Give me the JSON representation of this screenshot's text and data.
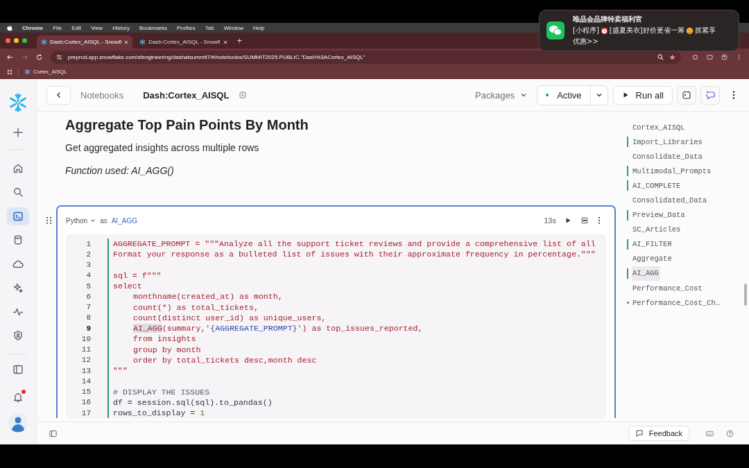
{
  "menu_bar": {
    "app": "Chrome",
    "items": [
      "File",
      "Edit",
      "View",
      "History",
      "Bookmarks",
      "Profiles",
      "Tab",
      "Window",
      "Help"
    ]
  },
  "browser": {
    "tabs": [
      {
        "title": "Dash:Cortex_AISQL - Snowfl",
        "selected": true
      },
      {
        "title": "Dash:Cortex_AISQL - Snowfl",
        "selected": false
      }
    ],
    "new_tab": "+",
    "url": "preprod.app.snowflake.com/sfengineering/dashatsummit7/#/notebooks/SUMMIT2025.PUBLIC.\"Dash%3ACortex_AISQL\"",
    "bookmarks": [
      "Cortex_AISQL"
    ]
  },
  "notification": {
    "title": "唯品会品牌特卖福利官",
    "line_1": [
      {
        "kind": "text",
        "text": "[小程序]"
      },
      {
        "kind": "clock"
      },
      {
        "kind": "text",
        "text": "[盛夏美衣]好价更省一筹"
      },
      {
        "kind": "smile"
      },
      {
        "kind": "text",
        "text": "抓紧享"
      }
    ],
    "line_2": "优惠>>"
  },
  "sidebar": {
    "items": [
      {
        "kind": "plus",
        "selected": false
      },
      {
        "kind": "home",
        "selected": false
      },
      {
        "kind": "search",
        "selected": false
      },
      {
        "kind": "terminal",
        "selected": true
      },
      {
        "kind": "database",
        "selected": false
      },
      {
        "kind": "cloud",
        "selected": false
      },
      {
        "kind": "sparkle",
        "selected": false
      },
      {
        "kind": "activity",
        "selected": false
      },
      {
        "kind": "shield",
        "selected": false
      }
    ],
    "notification_dot": true
  },
  "header": {
    "breadcrumb": "Notebooks",
    "title": "Dash:Cortex_AISQL",
    "packages": "Packages",
    "status": "Active",
    "run_all": "Run all"
  },
  "markdown": {
    "heading": "Aggregate Top Pain Points By Month",
    "text": "Get aggregated insights across multiple rows",
    "note": "Function used: AI_AGG()"
  },
  "cell": {
    "language": "Python",
    "as": "as",
    "name": "AI_AGG",
    "duration": "13s",
    "selected": true,
    "lines": [
      {
        "number": "1",
        "segments": [
          {
            "kind": "code",
            "text": "AGGREGATE_PROMPT = \"\"\"Analyze all the support ticket reviews and provide a comprehensive list of all"
          }
        ]
      },
      {
        "number": "2",
        "segments": [
          {
            "kind": "code",
            "text": "Format your response as a bulleted list of issues with their approximate frequency in percentage.\"\"\""
          }
        ]
      },
      {
        "number": "3"
      },
      {
        "number": "4",
        "segments": [
          {
            "kind": "code",
            "text": "sql = f\"\"\""
          }
        ]
      },
      {
        "number": "5",
        "segments": [
          {
            "kind": "code",
            "text": "select"
          }
        ]
      },
      {
        "number": "6",
        "indent": true,
        "segments": [
          {
            "kind": "code",
            "text": "monthname(created_at) as month,"
          }
        ]
      },
      {
        "number": "7",
        "indent": true,
        "segments": [
          {
            "kind": "code",
            "text": "count(*) as total_tickets,"
          }
        ]
      },
      {
        "number": "8",
        "indent": true,
        "segments": [
          {
            "kind": "code",
            "text": "count(distinct user_id) as unique_users,"
          }
        ]
      },
      {
        "number": "9",
        "indent": true,
        "segments": [
          {
            "kind": "match",
            "text": "AI_AGG"
          },
          {
            "kind": "code",
            "text": "(summary,'"
          },
          {
            "kind": "var",
            "text": "{AGGREGATE_PROMPT}"
          },
          {
            "kind": "code",
            "text": "') as top_issues_reported,"
          }
        ]
      },
      {
        "number": "10",
        "indent": true,
        "segments": [
          {
            "kind": "code",
            "text": "from insights"
          }
        ]
      },
      {
        "number": "11",
        "indent": true,
        "segments": [
          {
            "kind": "code",
            "text": "group by month"
          }
        ]
      },
      {
        "number": "12",
        "indent": true,
        "segments": [
          {
            "kind": "code",
            "text": "order by total_tickets desc,month desc"
          }
        ]
      },
      {
        "number": "13",
        "segments": [
          {
            "kind": "code",
            "text": "\"\"\""
          }
        ]
      },
      {
        "number": "14"
      },
      {
        "number": "15",
        "segments": [
          {
            "kind": "comment",
            "text": "# DISPLAY THE ISSUES"
          }
        ]
      },
      {
        "number": "16",
        "segments": [
          {
            "kind": "plain",
            "text": "df = session.sql(sql).to_pandas()"
          }
        ]
      },
      {
        "number": "17",
        "segments": [
          {
            "kind": "plain",
            "text": "rows_to_display = "
          },
          {
            "kind": "number",
            "text": "1"
          }
        ]
      }
    ]
  },
  "outline": [
    {
      "label": "Cortex_AISQL",
      "kind": "none",
      "selected": false
    },
    {
      "label": "Import_Libraries",
      "kind": "bar",
      "selected": false
    },
    {
      "label": "Consolidate_Data",
      "kind": "none",
      "selected": false
    },
    {
      "label": "Multimodal_Prompts",
      "kind": "bar",
      "selected": false
    },
    {
      "label": "AI_COMPLETE",
      "kind": "bar",
      "selected": false
    },
    {
      "label": "Consolidated_Data",
      "kind": "none",
      "selected": false
    },
    {
      "label": "Preview_Data",
      "kind": "bar",
      "selected": false
    },
    {
      "label": "SC_Articles",
      "kind": "none",
      "selected": false
    },
    {
      "label": "AI_FILTER",
      "kind": "bar",
      "selected": false
    },
    {
      "label": "Aggregate",
      "kind": "none",
      "selected": false
    },
    {
      "label": "AI_AGG",
      "kind": "bar",
      "selected": true
    },
    {
      "label": "Performance_Cost",
      "kind": "none",
      "selected": false
    },
    {
      "label": "Performance_Cost_Ch…",
      "kind": "dot",
      "selected": false
    }
  ],
  "footer": {
    "feedback": "Feedback"
  }
}
